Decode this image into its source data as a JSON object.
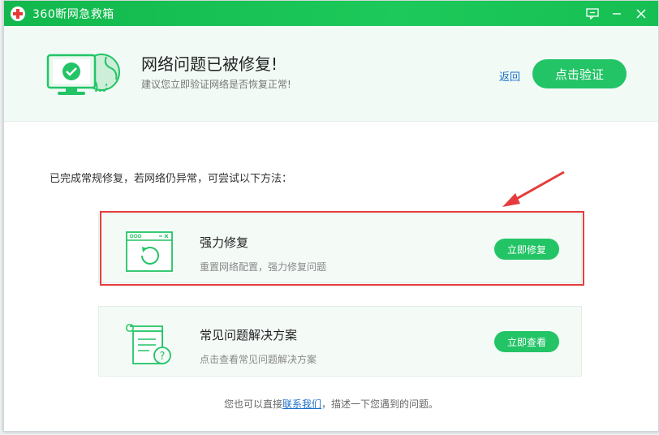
{
  "window": {
    "title": "360断网急救箱"
  },
  "header": {
    "title": "网络问题已被修复!",
    "subtitle": "建议您立即验证网络是否恢复正常!",
    "back_label": "返回",
    "verify_label": "点击验证"
  },
  "hint": "已完成常规修复，若网络仍异常，可尝试以下方法：",
  "cards": [
    {
      "title": "强力修复",
      "desc": "重置网络配置，强力修复问题",
      "button": "立即修复",
      "icon": "window-refresh-icon"
    },
    {
      "title": "常见问题解决方案",
      "desc": "点击查看常见问题解决方案",
      "button": "立即查看",
      "icon": "document-question-icon"
    }
  ],
  "footer": {
    "prefix": "您也可以直接",
    "link": "联系我们",
    "suffix": "，描述一下您遇到的问题。"
  },
  "colors": {
    "brand_green": "#23c466",
    "titlebar_green": "#12b84d",
    "link_blue": "#1a6fc9",
    "annotation_red": "#e53d3d"
  }
}
